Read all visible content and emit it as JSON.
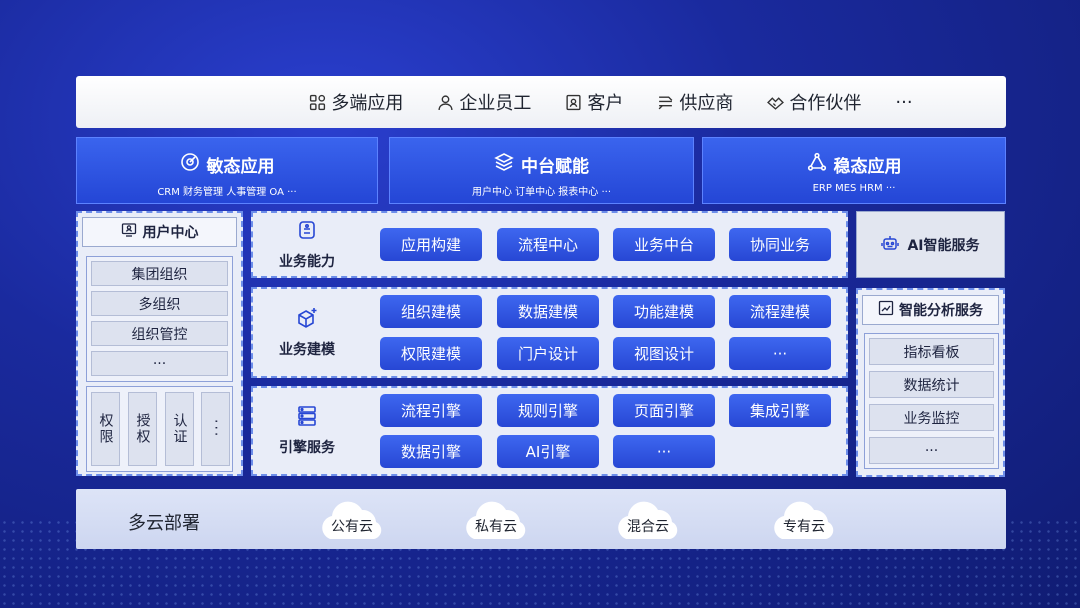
{
  "top_bar": {
    "items": [
      {
        "label": "多端应用",
        "icon": "apps-icon"
      },
      {
        "label": "企业员工",
        "icon": "user-icon"
      },
      {
        "label": "客户",
        "icon": "contact-card-icon"
      },
      {
        "label": "供应商",
        "icon": "supplier-icon"
      },
      {
        "label": "合作伙伴",
        "icon": "handshake-icon"
      }
    ],
    "more": "···"
  },
  "headers": [
    {
      "title": "敏态应用",
      "subtitle": "CRM  财务管理  人事管理  OA ···",
      "icon": "target-icon"
    },
    {
      "title": "中台赋能",
      "subtitle": "用户中心  订单中心  报表中心 ···",
      "icon": "layers-icon"
    },
    {
      "title": "稳态应用",
      "subtitle": "ERP MES HRM ···",
      "icon": "triangle-nodes-icon"
    }
  ],
  "user_center": {
    "title": "用户中心",
    "groups": [
      "集团组织",
      "多组织",
      "组织管控",
      "···"
    ],
    "auth": [
      "权限",
      "授权",
      "认证",
      "···"
    ]
  },
  "rows": [
    {
      "label": "业务能力",
      "icon": "service-icon",
      "chips": [
        "应用构建",
        "流程中心",
        "业务中台",
        "协同业务"
      ]
    },
    {
      "label": "业务建模",
      "icon": "cube-plus-icon",
      "chips": [
        "组织建模",
        "数据建模",
        "功能建模",
        "流程建模",
        "权限建模",
        "门户设计",
        "视图设计",
        "···"
      ]
    },
    {
      "label": "引擎服务",
      "icon": "server-icon",
      "chips": [
        "流程引擎",
        "规则引擎",
        "页面引擎",
        "集成引擎",
        "数据引擎",
        "AI引擎",
        "···"
      ]
    }
  ],
  "ai_service": {
    "title": "AI智能服务",
    "icon": "robot-icon"
  },
  "analysis_service": {
    "title": "智能分析服务",
    "icon": "chart-icon",
    "items": [
      "指标看板",
      "数据统计",
      "业务监控",
      "···"
    ]
  },
  "cloud_deploy": {
    "label": "多云部署",
    "clouds": [
      "公有云",
      "私有云",
      "混合云",
      "专有云"
    ]
  },
  "colors": {
    "accent": "#2f55e0",
    "background": "#1a2a9e"
  }
}
